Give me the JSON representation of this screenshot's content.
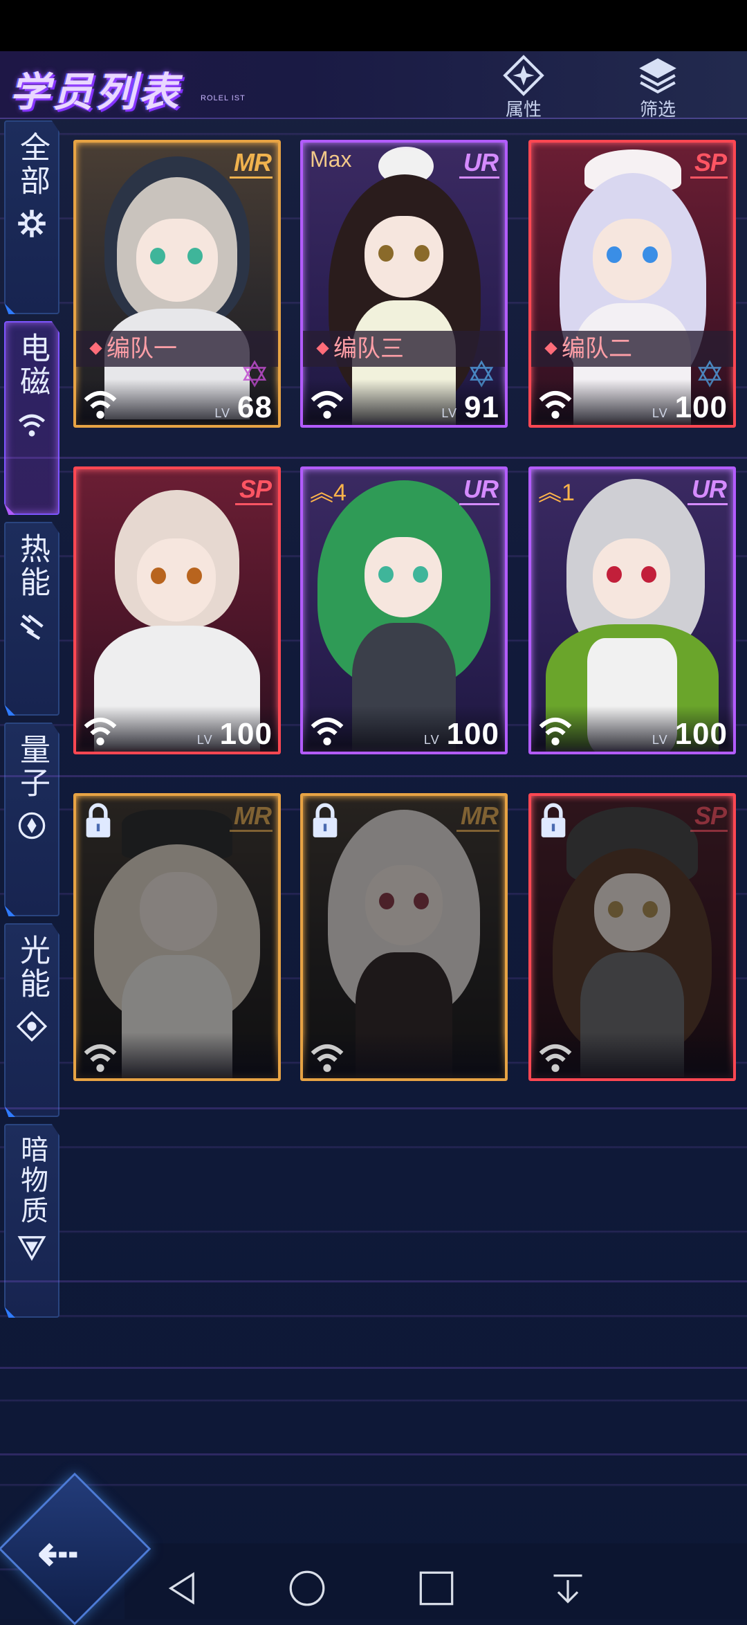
{
  "header": {
    "title": "学员列表",
    "subtitle": "ROLEL IST",
    "attr_label": "属性",
    "filter_label": "筛选"
  },
  "tabs": [
    {
      "label": "全部",
      "icon": "gear-icon",
      "active": false
    },
    {
      "label": "电磁",
      "icon": "wifi-icon",
      "active": true
    },
    {
      "label": "热能",
      "icon": "heat-icon",
      "active": false
    },
    {
      "label": "量子",
      "icon": "quantum-icon",
      "active": false
    },
    {
      "label": "光能",
      "icon": "light-icon",
      "active": false
    },
    {
      "label": "暗物质",
      "icon": "dark-matter-icon",
      "active": false
    }
  ],
  "cards": [
    {
      "rarity": "MR",
      "badge": "",
      "team": "编队一",
      "level_prefix": "LV",
      "level": "68",
      "locked": false
    },
    {
      "rarity": "UR",
      "badge": "Max",
      "team": "编队三",
      "level_prefix": "LV",
      "level": "91",
      "locked": false
    },
    {
      "rarity": "SP",
      "badge": "",
      "team": "编队二",
      "level_prefix": "LV",
      "level": "100",
      "locked": false
    },
    {
      "rarity": "SP",
      "badge": "",
      "team": "",
      "level_prefix": "LV",
      "level": "100",
      "locked": false
    },
    {
      "rarity": "UR",
      "badge": "4",
      "team": "",
      "level_prefix": "LV",
      "level": "100",
      "locked": false
    },
    {
      "rarity": "UR",
      "badge": "1",
      "team": "",
      "level_prefix": "LV",
      "level": "100",
      "locked": false
    },
    {
      "rarity": "MR",
      "badge": "",
      "team": "",
      "level_prefix": "",
      "level": "",
      "locked": true
    },
    {
      "rarity": "MR",
      "badge": "",
      "team": "",
      "level_prefix": "",
      "level": "",
      "locked": true
    },
    {
      "rarity": "SP",
      "badge": "",
      "team": "",
      "level_prefix": "",
      "level": "",
      "locked": true
    }
  ],
  "nav": {
    "back_icon": "back-arrow-icon",
    "system_icons": [
      "system-back-icon",
      "home-circle-icon",
      "recents-square-icon",
      "notification-pull-icon"
    ]
  },
  "colors": {
    "mr": "#e7a344",
    "ur": "#b35cff",
    "sp": "#ff4752",
    "background": "#0d1733"
  }
}
